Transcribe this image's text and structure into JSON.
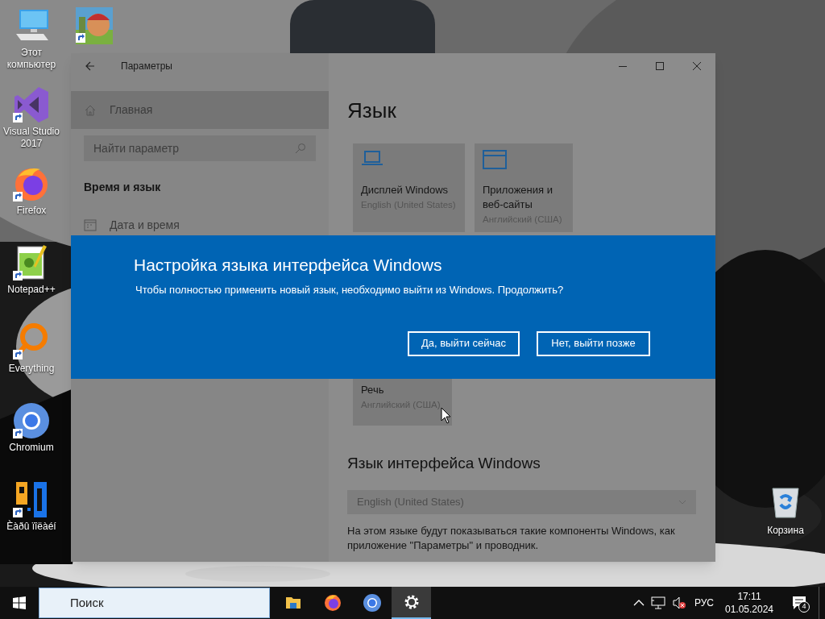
{
  "desktop_icons": [
    {
      "kind": "computer",
      "label": "Этот компьютер"
    },
    {
      "kind": "vs",
      "label": "Visual Studio 2017"
    },
    {
      "kind": "firefox",
      "label": "Firefox"
    },
    {
      "kind": "notepad",
      "label": "Notepad++"
    },
    {
      "kind": "everything",
      "label": "Everything"
    },
    {
      "kind": "chromium",
      "label": "Chromium"
    },
    {
      "kind": "pg",
      "label": "Èàðû ïîëàéí"
    }
  ],
  "extra_icons": [
    {
      "kind": "game"
    }
  ],
  "recycle_bin": {
    "label": "Корзина"
  },
  "window": {
    "title": "Параметры",
    "home": {
      "label": "Главная",
      "selected": true
    },
    "search": {
      "placeholder": "Найти параметр"
    },
    "section": "Время и язык",
    "nav_items": [
      {
        "label": "Дата и время",
        "selected": false
      }
    ],
    "heading": "Язык",
    "tiles": [
      {
        "kind": "display",
        "title": "Дисплей Windows",
        "subtitle": "English (United States)"
      },
      {
        "kind": "apps",
        "title": "Приложения и веб-сайты",
        "subtitle": "Английский (США)"
      },
      {
        "kind": "speech",
        "title": "Речь",
        "subtitle": "Английский (США)"
      }
    ],
    "interface_heading": "Язык интерфейса Windows",
    "dropdown": {
      "value": "English (United States)",
      "disabled": true
    },
    "description": "На этом языке будут показываться такие компоненты Windows, как приложение \"Параметры\" и проводник."
  },
  "dialog": {
    "title": "Настройка языка интерфейса Windows",
    "message": "Чтобы полностью применить новый язык, необходимо выйти из Windows. Продолжить?",
    "buttons": [
      {
        "label": "Да, выйти сейчас"
      },
      {
        "label": "Нет, выйти позже"
      }
    ]
  },
  "taskbar": {
    "search": {
      "placeholder": "Поиск"
    },
    "apps": [
      {
        "kind": "explorer",
        "active": false
      },
      {
        "kind": "firefox",
        "active": false
      },
      {
        "kind": "chromium",
        "active": false
      },
      {
        "kind": "settings",
        "active": true
      }
    ],
    "language": "РУС",
    "time": "17:11",
    "date": "01.05.2024",
    "notifications": "4"
  }
}
